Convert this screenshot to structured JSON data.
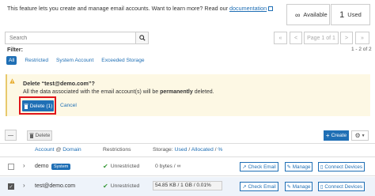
{
  "intro": {
    "text": "This feature lets you create and manage email accounts. Want to learn more? Read our ",
    "link": "documentation"
  },
  "stats": {
    "available_icon": "∞",
    "available_label": "Available",
    "used_value": "1",
    "used_label": "Used"
  },
  "search": {
    "placeholder": "Search",
    "icon": "search-icon"
  },
  "pager": {
    "first": "«",
    "prev": "<",
    "page_label": "Page 1 of 1",
    "next": ">",
    "last": "»"
  },
  "filter": {
    "label": "Filter:",
    "count": "1 - 2 of 2",
    "options": [
      "All",
      "Restricted",
      "System Account",
      "Exceeded Storage"
    ]
  },
  "warning": {
    "title": "Delete “test@demo.com”?",
    "text_before": "All the data associated with the email account(s) will be ",
    "text_bold": "permanently",
    "text_after": " deleted.",
    "delete_label": "Delete (1)",
    "cancel_label": "Cancel"
  },
  "toolbar": {
    "delete_label": "Delete",
    "create_label": "Create"
  },
  "table": {
    "headers": {
      "account": "Account",
      "at": "@",
      "domain": "Domain",
      "restrictions": "Restrictions",
      "storage_prefix": "Storage: ",
      "used": "Used",
      "sep1": " / ",
      "allocated": "Allocated",
      "sep2": " / ",
      "pct": "%"
    },
    "rows": [
      {
        "account": "demo",
        "badge": "System",
        "restriction": "Unrestricted",
        "storage": "0 bytes / ∞",
        "checked": false
      },
      {
        "account": "test@demo.com",
        "restriction": "Unrestricted",
        "storage": "54.85 KB / 1 GB / 0.01%",
        "storage_fraction": 0.0001,
        "checked": true
      }
    ],
    "actions": {
      "check_email": "Check Email",
      "manage": "Manage",
      "connect": "Connect Devices"
    }
  },
  "colors": {
    "accent": "#1f6fb5",
    "warning_bg": "#fdf8e4",
    "highlight": "#e0151a",
    "success": "#3a9a3a"
  }
}
